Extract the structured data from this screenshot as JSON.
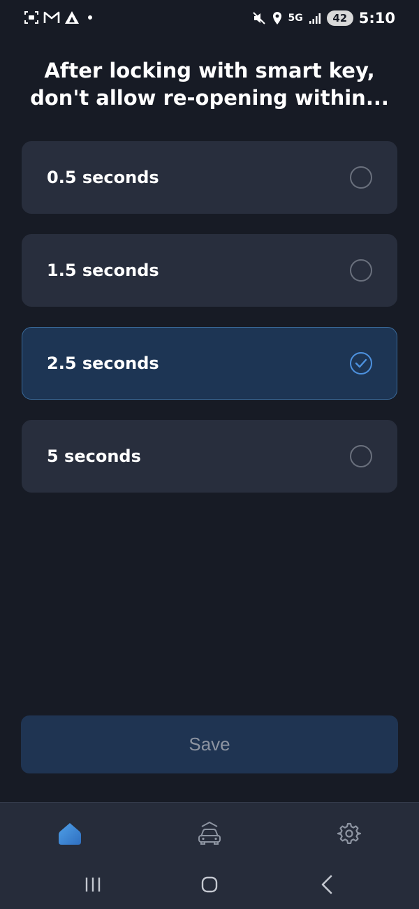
{
  "status_bar": {
    "time": "5:10",
    "network": "5G",
    "battery": "42",
    "left_icons": [
      "screenshot-icon",
      "gmail-icon",
      "app-icon",
      "dot-icon"
    ],
    "right_icons": [
      "mute-icon",
      "location-icon",
      "signal-icon"
    ]
  },
  "title": "After locking with smart key, don't allow re-opening within...",
  "options": [
    {
      "label": "0.5 seconds",
      "selected": false
    },
    {
      "label": "1.5 seconds",
      "selected": false
    },
    {
      "label": "2.5 seconds",
      "selected": true
    },
    {
      "label": "5 seconds",
      "selected": false
    }
  ],
  "save_label": "Save",
  "bottom_nav": {
    "items": [
      {
        "icon": "home-icon",
        "active": true
      },
      {
        "icon": "car-icon",
        "active": false
      },
      {
        "icon": "gear-icon",
        "active": false
      }
    ]
  },
  "system_nav": [
    "recents-icon",
    "home-button-icon",
    "back-icon"
  ],
  "colors": {
    "background": "#171b25",
    "card": "#282e3d",
    "selected_card": "#1d3554",
    "accent": "#4d91de",
    "save_button": "#1f3452"
  }
}
